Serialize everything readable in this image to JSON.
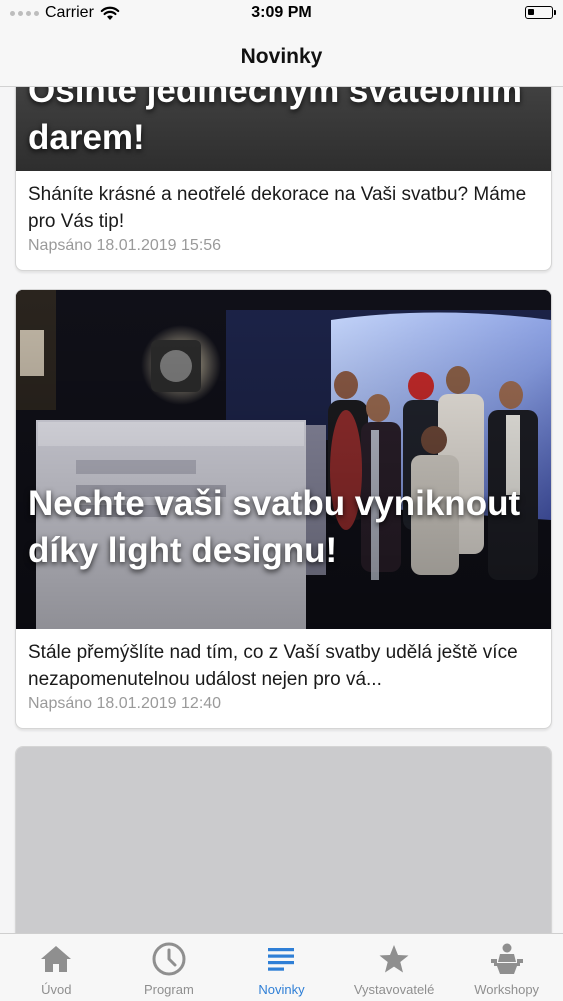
{
  "status_bar": {
    "carrier": "Carrier",
    "time": "3:09 PM"
  },
  "nav": {
    "title": "Novinky"
  },
  "articles": [
    {
      "title": "Oslňte jedinečným svatebním darem!",
      "excerpt": "Sháníte krásné a neotřelé dekorace na Vaši svatbu? Máme pro Vás tip!",
      "date": "Napsáno 18.01.2019 15:56"
    },
    {
      "title": "Nechte vaši svatbu vyniknout díky light designu!",
      "excerpt": "Stále přemýšlíte nad tím, co z Vaší svatby udělá ještě více nezapomenutelnou událost nejen pro vá...",
      "date": "Napsáno 18.01.2019 12:40"
    }
  ],
  "tabs": [
    {
      "label": "Úvod",
      "icon": "home-icon",
      "active": false
    },
    {
      "label": "Program",
      "icon": "clock-icon",
      "active": false
    },
    {
      "label": "Novinky",
      "icon": "list-icon",
      "active": true
    },
    {
      "label": "Vystavovatelé",
      "icon": "star-icon",
      "active": false
    },
    {
      "label": "Workshopy",
      "icon": "workshop-icon",
      "active": false
    }
  ],
  "colors": {
    "accent": "#2f7fd6",
    "inactive": "#8f8f8f",
    "bar_background": "#f7f7f7"
  }
}
